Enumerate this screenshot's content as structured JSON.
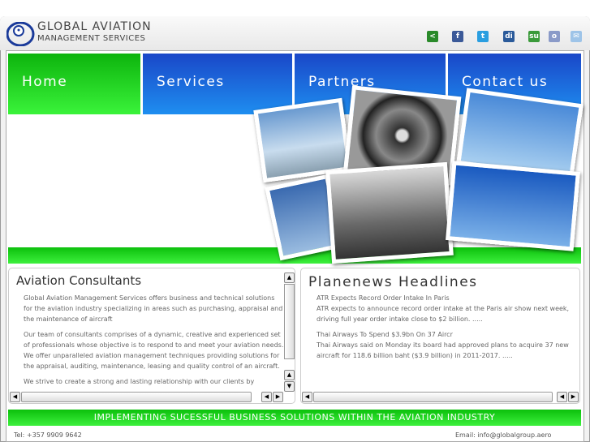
{
  "brand": {
    "line1": "GLOBAL AVIATION",
    "line2": "MANAGEMENT SERVICES"
  },
  "social": [
    {
      "name": "share",
      "color": "#2a8a2a",
      "glyph": "<"
    },
    {
      "name": "facebook",
      "color": "#3b5998",
      "glyph": "f"
    },
    {
      "name": "twitter",
      "color": "#2a9ee0",
      "glyph": "t"
    },
    {
      "name": "digg",
      "color": "#2a5a9a",
      "glyph": "di"
    },
    {
      "name": "stumbleupon",
      "color": "#3a9a3a",
      "glyph": "su"
    },
    {
      "name": "delicious",
      "color": "#8a9ac8",
      "glyph": "o"
    },
    {
      "name": "email",
      "color": "#9ec4e8",
      "glyph": "✉"
    }
  ],
  "nav": [
    {
      "label": "Home"
    },
    {
      "label": "Services"
    },
    {
      "label": "Partners"
    },
    {
      "label": "Contact us"
    }
  ],
  "consultants": {
    "title": "Aviation Consultants",
    "paragraphs": [
      "Global Aviation Management Services offers business and technical solutions for the aviation industry specializing in areas such as purchasing, appraisal and the maintenance of aircraft",
      "Our team of consultants comprises of a dynamic, creative and experienced set of professionals whose objective is to respond to and meet your aviation needs. We offer unparalleled aviation management techniques providing solutions for the appraisal, auditing, maintenance, leasing and quality control of an aircraft.",
      "We strive to create a strong and lasting relationship with our clients by"
    ]
  },
  "news": {
    "title": "Planenews Headlines",
    "items": [
      {
        "headline": "ATR Expects Record Order Intake In Paris",
        "summary": "ATR expects to announce record order intake at the Paris air show next week, driving full year order intake close to $2 billion. ....."
      },
      {
        "headline": "Thai Airways To Spend $3.9bn On 37 Aircr",
        "summary": "Thai Airways said on Monday its board had approved plans to acquire 37 new aircraft for 118.6 billion baht ($3.9 billion) in 2011-2017. ....."
      }
    ]
  },
  "banner": "IMPLEMENTING SUCESSFUL BUSINESS SOLUTIONS WITHIN THE AVIATION INDUSTRY",
  "footer": {
    "tel": "Tel: +357 9909 9642",
    "email": "Email: info@globalgroup.aero"
  }
}
